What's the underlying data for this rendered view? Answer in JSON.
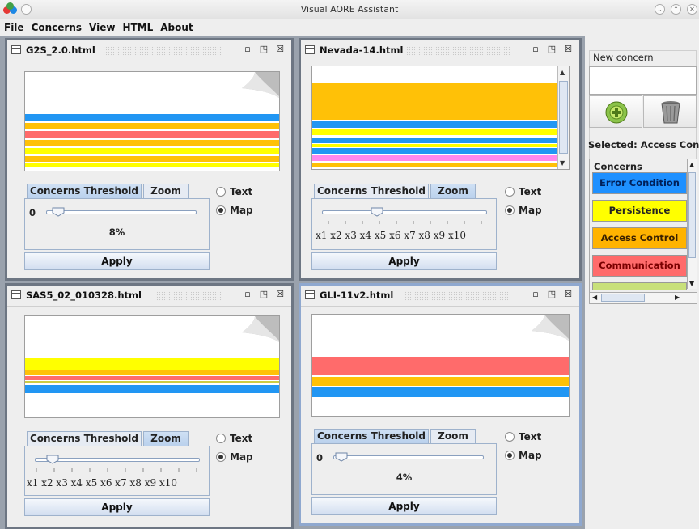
{
  "window": {
    "title": "Visual AORE Assistant"
  },
  "menu": {
    "items": [
      "File",
      "Concerns",
      "View",
      "HTML",
      "About"
    ]
  },
  "frames": [
    {
      "name": "G2S_2.0.html",
      "tabs": [
        "Concerns Threshold",
        "Zoom"
      ],
      "selected_tab": "Concerns Threshold",
      "threshold_min": "0",
      "threshold_value": "8%",
      "threshold_fraction": 0.08,
      "radio": {
        "text": "Text",
        "map": "Map",
        "selected": "Map"
      },
      "apply": "Apply",
      "strips": [
        "#2196f3",
        "#ffc107",
        "#ff6b6b",
        "#ffc107",
        "#ffff00",
        "#ffc107",
        "#ffff00"
      ]
    },
    {
      "name": "Nevada-14.html",
      "tabs": [
        "Concerns Threshold",
        "Zoom"
      ],
      "selected_tab": "Zoom",
      "zoom_labels": "x1  x2  x3  x4  x5  x6  x7  x8  x9 x10",
      "zoom_level": 4,
      "radio": {
        "text": "Text",
        "map": "Map",
        "selected": "Map"
      },
      "apply": "Apply",
      "strips": [
        "#ffc107",
        "#2196f3",
        "#ffff00",
        "#2196f3",
        "#ffff00",
        "#2196f3",
        "#ff88ee",
        "#ffc107"
      ]
    },
    {
      "name": "SAS5_02_010328.html",
      "tabs": [
        "Concerns Threshold",
        "Zoom"
      ],
      "selected_tab": "Zoom",
      "zoom_labels": "x1  x2  x3  x4  x5  x6  x7  x8  x9 x10",
      "zoom_level": 2,
      "radio": {
        "text": "Text",
        "map": "Map",
        "selected": "Map"
      },
      "apply": "Apply",
      "strips": [
        "#ffff00",
        "#ffc107",
        "#ff6b6b",
        "#cccc44",
        "#2196f3"
      ]
    },
    {
      "name": "GLI-11v2.html",
      "tabs": [
        "Concerns Threshold",
        "Zoom"
      ],
      "selected_tab": "Concerns Threshold",
      "threshold_min": "0",
      "threshold_value": "4%",
      "threshold_fraction": 0.04,
      "radio": {
        "text": "Text",
        "map": "Map",
        "selected": "Map"
      },
      "apply": "Apply",
      "strips": [
        "#ff6b6b",
        "#ffc107",
        "#2196f3"
      ]
    }
  ],
  "right_panel": {
    "new_concern_label": "New concern",
    "new_concern_value": "",
    "add_icon": "add-concern-icon",
    "trash_icon": "trash-icon",
    "selected_label": "Selected: Access Con...",
    "concerns_label": "Concerns",
    "concerns": [
      {
        "name": "Error Condition",
        "color": "#1e90ff"
      },
      {
        "name": "Persistence",
        "color": "#ffff00"
      },
      {
        "name": "Access Control",
        "color": "#ffb300"
      },
      {
        "name": "Communication",
        "color": "#ff6b6b"
      }
    ]
  }
}
